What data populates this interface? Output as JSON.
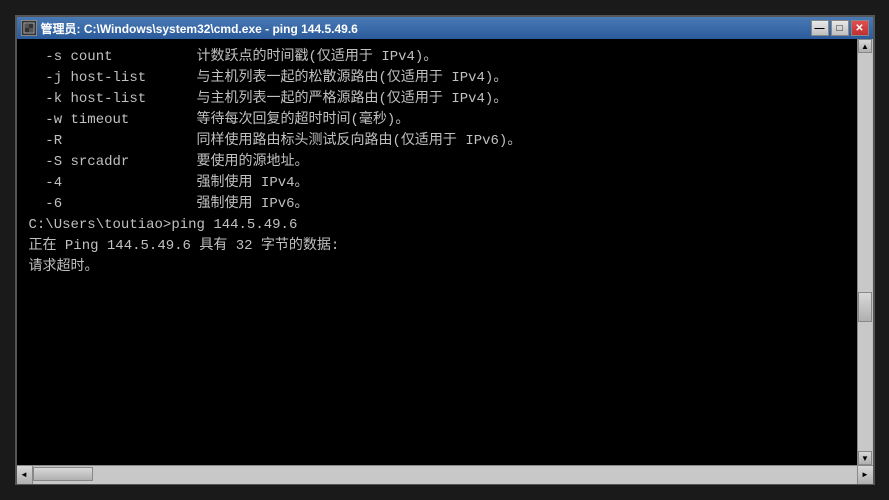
{
  "window": {
    "title": "管理员: C:\\Windows\\system32\\cmd.exe - ping  144.5.49.6",
    "icon_label": "C"
  },
  "titlebar_buttons": {
    "minimize": "—",
    "maximize": "□",
    "close": "✕"
  },
  "console": {
    "lines": [
      "  -s count          计数跃点的时间戳(仅适用于 IPv4)。",
      "  -j host-list      与主机列表一起的松散源路由(仅适用于 IPv4)。",
      "  -k host-list      与主机列表一起的严格源路由(仅适用于 IPv4)。",
      "  -w timeout        等待每次回复的超时时间(毫秒)。",
      "  -R                同样使用路由标头测试反向路由(仅适用于 IPv6)。",
      "  -S srcaddr        要使用的源地址。",
      "  -4                强制使用 IPv4。",
      "  -6                强制使用 IPv6。",
      "",
      "",
      "C:\\Users\\toutiao>ping 144.5.49.6",
      "",
      "正在 Ping 144.5.49.6 具有 32 字节的数据:",
      "请求超时。"
    ]
  },
  "scrollbar": {
    "up_arrow": "▲",
    "down_arrow": "▼",
    "left_arrow": "◄",
    "right_arrow": "►"
  }
}
